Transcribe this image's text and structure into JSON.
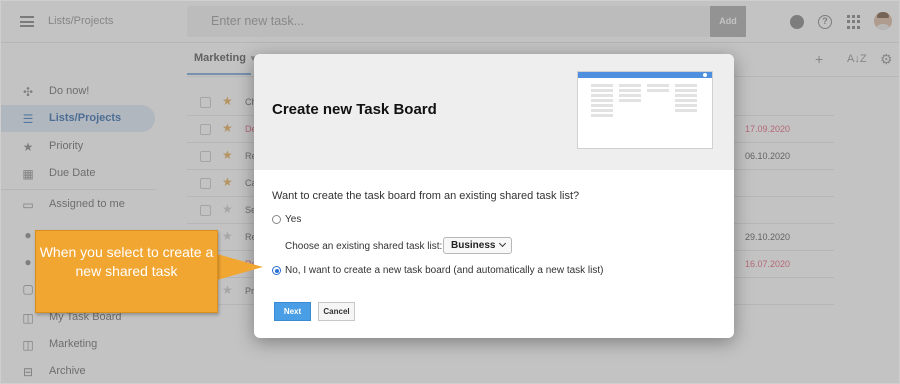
{
  "topbar": {
    "breadcrumb": "Lists/Projects",
    "new_task_placeholder": "Enter new task...",
    "add_label": "Add"
  },
  "sidebar": {
    "items": [
      {
        "label": "Do now!",
        "icon": "gamepad-icon"
      },
      {
        "label": "Lists/Projects",
        "icon": "list-icon",
        "active": true
      },
      {
        "label": "Priority",
        "icon": "star-icon"
      },
      {
        "label": "Due Date",
        "icon": "calendar-icon"
      },
      {
        "label": "Assigned to me",
        "icon": "inbox-icon"
      },
      {
        "label": "My Task Board",
        "icon": "board-icon"
      },
      {
        "label": "Marketing",
        "icon": "board-icon"
      },
      {
        "label": "Archive",
        "icon": "archive-icon"
      }
    ]
  },
  "content": {
    "tab": "Marketing",
    "tasks": [
      {
        "title": "Ch",
        "due": "",
        "star_color": "#e2a645",
        "title_color": "#555555"
      },
      {
        "title": "De",
        "due": "17.09.2020",
        "star_color": "#e2a645",
        "title_color": "#e0506f",
        "due_color": "#e0506f"
      },
      {
        "title": "Re",
        "due": "06.10.2020",
        "star_color": "#e2a645",
        "title_color": "#555555"
      },
      {
        "title": "Ca",
        "due": "",
        "star_color": "#e2a645",
        "title_color": "#555555"
      },
      {
        "title": "Se",
        "due": "",
        "star_color": "#c8c8c8",
        "title_color": "#555555"
      },
      {
        "title": "Re",
        "due": "29.10.2020",
        "star_color": "#c8c8c8",
        "title_color": "#555555"
      },
      {
        "title": "Re",
        "due": "16.07.2020",
        "star_color": "#c8c8c8",
        "title_color": "#e0506f",
        "due_color": "#e0506f"
      },
      {
        "title": "Pr",
        "due": "",
        "star_color": "#c8c8c8",
        "title_color": "#555555"
      }
    ]
  },
  "modal": {
    "title": "Create new Task Board",
    "question": "Want to create the task board from an existing shared task list?",
    "option_yes": "Yes",
    "choose_label": "Choose an existing shared task list:",
    "selected_list": "Business",
    "option_new": "No, I want to create a new task board (and automatically a new task list)",
    "next_label": "Next",
    "cancel_label": "Cancel"
  },
  "callout": {
    "text": "When you select to create a new shared task"
  },
  "colors": {
    "accent": "#4a9ee6",
    "callout": "#f1a632",
    "overdue": "#e0506f",
    "sidebar_active_bg": "#dbe9f6"
  }
}
